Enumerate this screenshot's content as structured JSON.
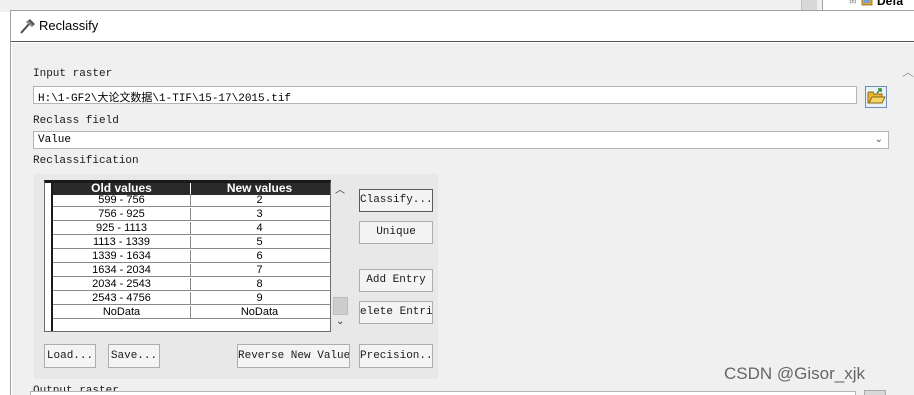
{
  "background": {
    "tree_item_label": "Defa"
  },
  "dialog": {
    "title": "Reclassify"
  },
  "input_raster": {
    "label": "Input raster",
    "value": "H:\\1-GF2\\大论文数据\\1-TIF\\15-17\\2015.tif"
  },
  "reclass_field": {
    "label": "Reclass field",
    "value": "Value"
  },
  "reclassification": {
    "label": "Reclassification",
    "columns": [
      "Old values",
      "New values"
    ],
    "rows": [
      {
        "old": "599 - 756",
        "new": "2"
      },
      {
        "old": "756 - 925",
        "new": "3"
      },
      {
        "old": "925 - 1113",
        "new": "4"
      },
      {
        "old": "1113 - 1339",
        "new": "5"
      },
      {
        "old": "1339 - 1634",
        "new": "6"
      },
      {
        "old": "1634 - 2034",
        "new": "7"
      },
      {
        "old": "2034 - 2543",
        "new": "8"
      },
      {
        "old": "2543 - 4756",
        "new": "9"
      },
      {
        "old": "NoData",
        "new": "NoData"
      }
    ]
  },
  "buttons": {
    "classify": "Classify...",
    "unique": "Unique",
    "add_entry": "Add Entry",
    "delete_entries": "elete Entrie",
    "load": "Load...",
    "save": "Save...",
    "reverse": "Reverse New Values",
    "precision": "Precision..."
  },
  "output_raster": {
    "label": "Output raster"
  },
  "watermark": "CSDN @Gisor_xjk",
  "colors": {
    "grid_header_bg": "#2a2a2a",
    "dialog_bg": "#f0f0f0",
    "folder_icon": "#e8b630"
  },
  "icons": {
    "title": "hammer-icon",
    "browse": "open-folder-icon",
    "tree_item": "layer-icon"
  }
}
